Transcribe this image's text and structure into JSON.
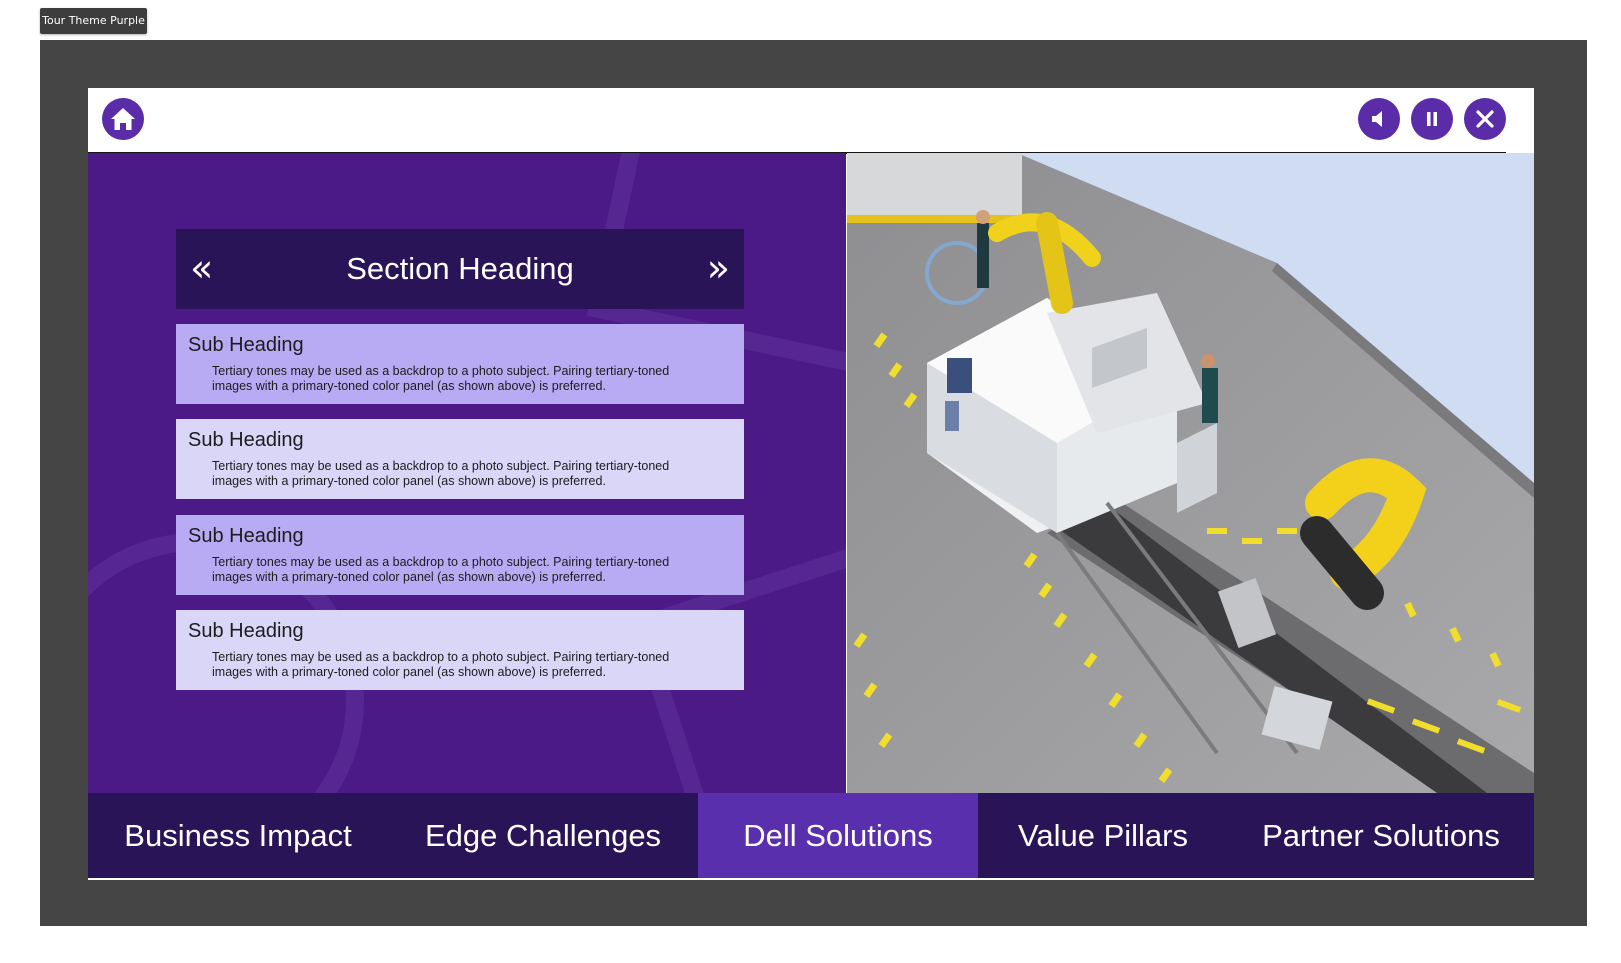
{
  "badge": {
    "label": "Tour Theme Purple"
  },
  "toolbar": {
    "home_icon": "home-icon",
    "audio_icon": "speaker-icon",
    "pause_icon": "pause-icon",
    "close_icon": "close-icon"
  },
  "section": {
    "title": "Section Heading",
    "prev_glyph": "«",
    "next_glyph": "»"
  },
  "cards": [
    {
      "title": "Sub Heading",
      "body": "Tertiary tones may be used as a backdrop to a photo subject. Pairing tertiary-toned images with a primary-toned color panel (as shown above) is preferred."
    },
    {
      "title": "Sub Heading",
      "body": "Tertiary tones may be used as a backdrop to a photo subject. Pairing tertiary-toned images with a primary-toned color panel (as shown above) is preferred."
    },
    {
      "title": "Sub Heading",
      "body": "Tertiary tones may be used as a backdrop to a photo subject. Pairing tertiary-toned images with a primary-toned color panel (as shown above) is preferred."
    },
    {
      "title": "Sub Heading",
      "body": "Tertiary tones may be used as a backdrop to a photo subject. Pairing tertiary-toned images with a primary-toned color panel (as shown above) is preferred."
    }
  ],
  "nav": {
    "tabs": [
      {
        "label": "Business Impact",
        "active": false
      },
      {
        "label": "Edge Challenges",
        "active": false
      },
      {
        "label": "Dell Solutions",
        "active": true
      },
      {
        "label": "Value Pillars",
        "active": false
      },
      {
        "label": "Partner Solutions",
        "active": false
      }
    ]
  },
  "colors": {
    "accent": "#5a2ca8",
    "panel": "#4c1a87",
    "header": "#2a1458",
    "card_dark": "#b8abf4",
    "card_light": "#dad6f8"
  }
}
